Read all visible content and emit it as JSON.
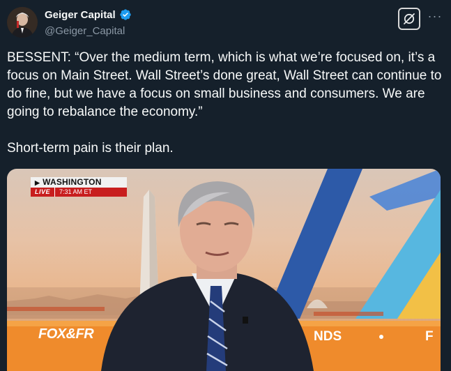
{
  "tweet": {
    "author": {
      "display_name": "Geiger Capital",
      "handle": "@Geiger_Capital",
      "verified": true,
      "verified_color": "#1d9bf0"
    },
    "icons": {
      "grok": "grok-icon",
      "more": "more-icon",
      "verified": "verified-badge-icon"
    },
    "more_label": "···",
    "paragraphs": [
      "BESSENT: “Over the medium term, which is what we’re focused on, it’s a focus on Main Street. Wall Street’s done great, Wall Street can continue to do fine, but we have a focus on small business and consumers. We are going to rebalance the economy.”",
      "Short-term pain is their plan."
    ]
  },
  "media": {
    "location_badge": {
      "location": "WASHINGTON",
      "live": "LIVE",
      "time": "7:31 AM ET"
    },
    "ticker": {
      "left": "FOX&FR",
      "middle": "NDS",
      "right": "F"
    }
  }
}
